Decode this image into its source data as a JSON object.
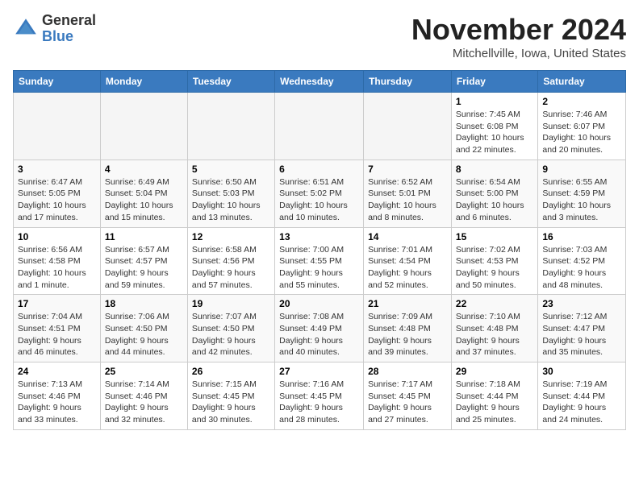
{
  "header": {
    "logo_line1": "General",
    "logo_line2": "Blue",
    "month": "November 2024",
    "location": "Mitchellville, Iowa, United States"
  },
  "weekdays": [
    "Sunday",
    "Monday",
    "Tuesday",
    "Wednesday",
    "Thursday",
    "Friday",
    "Saturday"
  ],
  "weeks": [
    [
      {
        "day": "",
        "info": ""
      },
      {
        "day": "",
        "info": ""
      },
      {
        "day": "",
        "info": ""
      },
      {
        "day": "",
        "info": ""
      },
      {
        "day": "",
        "info": ""
      },
      {
        "day": "1",
        "info": "Sunrise: 7:45 AM\nSunset: 6:08 PM\nDaylight: 10 hours and 22 minutes."
      },
      {
        "day": "2",
        "info": "Sunrise: 7:46 AM\nSunset: 6:07 PM\nDaylight: 10 hours and 20 minutes."
      }
    ],
    [
      {
        "day": "3",
        "info": "Sunrise: 6:47 AM\nSunset: 5:05 PM\nDaylight: 10 hours and 17 minutes."
      },
      {
        "day": "4",
        "info": "Sunrise: 6:49 AM\nSunset: 5:04 PM\nDaylight: 10 hours and 15 minutes."
      },
      {
        "day": "5",
        "info": "Sunrise: 6:50 AM\nSunset: 5:03 PM\nDaylight: 10 hours and 13 minutes."
      },
      {
        "day": "6",
        "info": "Sunrise: 6:51 AM\nSunset: 5:02 PM\nDaylight: 10 hours and 10 minutes."
      },
      {
        "day": "7",
        "info": "Sunrise: 6:52 AM\nSunset: 5:01 PM\nDaylight: 10 hours and 8 minutes."
      },
      {
        "day": "8",
        "info": "Sunrise: 6:54 AM\nSunset: 5:00 PM\nDaylight: 10 hours and 6 minutes."
      },
      {
        "day": "9",
        "info": "Sunrise: 6:55 AM\nSunset: 4:59 PM\nDaylight: 10 hours and 3 minutes."
      }
    ],
    [
      {
        "day": "10",
        "info": "Sunrise: 6:56 AM\nSunset: 4:58 PM\nDaylight: 10 hours and 1 minute."
      },
      {
        "day": "11",
        "info": "Sunrise: 6:57 AM\nSunset: 4:57 PM\nDaylight: 9 hours and 59 minutes."
      },
      {
        "day": "12",
        "info": "Sunrise: 6:58 AM\nSunset: 4:56 PM\nDaylight: 9 hours and 57 minutes."
      },
      {
        "day": "13",
        "info": "Sunrise: 7:00 AM\nSunset: 4:55 PM\nDaylight: 9 hours and 55 minutes."
      },
      {
        "day": "14",
        "info": "Sunrise: 7:01 AM\nSunset: 4:54 PM\nDaylight: 9 hours and 52 minutes."
      },
      {
        "day": "15",
        "info": "Sunrise: 7:02 AM\nSunset: 4:53 PM\nDaylight: 9 hours and 50 minutes."
      },
      {
        "day": "16",
        "info": "Sunrise: 7:03 AM\nSunset: 4:52 PM\nDaylight: 9 hours and 48 minutes."
      }
    ],
    [
      {
        "day": "17",
        "info": "Sunrise: 7:04 AM\nSunset: 4:51 PM\nDaylight: 9 hours and 46 minutes."
      },
      {
        "day": "18",
        "info": "Sunrise: 7:06 AM\nSunset: 4:50 PM\nDaylight: 9 hours and 44 minutes."
      },
      {
        "day": "19",
        "info": "Sunrise: 7:07 AM\nSunset: 4:50 PM\nDaylight: 9 hours and 42 minutes."
      },
      {
        "day": "20",
        "info": "Sunrise: 7:08 AM\nSunset: 4:49 PM\nDaylight: 9 hours and 40 minutes."
      },
      {
        "day": "21",
        "info": "Sunrise: 7:09 AM\nSunset: 4:48 PM\nDaylight: 9 hours and 39 minutes."
      },
      {
        "day": "22",
        "info": "Sunrise: 7:10 AM\nSunset: 4:48 PM\nDaylight: 9 hours and 37 minutes."
      },
      {
        "day": "23",
        "info": "Sunrise: 7:12 AM\nSunset: 4:47 PM\nDaylight: 9 hours and 35 minutes."
      }
    ],
    [
      {
        "day": "24",
        "info": "Sunrise: 7:13 AM\nSunset: 4:46 PM\nDaylight: 9 hours and 33 minutes."
      },
      {
        "day": "25",
        "info": "Sunrise: 7:14 AM\nSunset: 4:46 PM\nDaylight: 9 hours and 32 minutes."
      },
      {
        "day": "26",
        "info": "Sunrise: 7:15 AM\nSunset: 4:45 PM\nDaylight: 9 hours and 30 minutes."
      },
      {
        "day": "27",
        "info": "Sunrise: 7:16 AM\nSunset: 4:45 PM\nDaylight: 9 hours and 28 minutes."
      },
      {
        "day": "28",
        "info": "Sunrise: 7:17 AM\nSunset: 4:45 PM\nDaylight: 9 hours and 27 minutes."
      },
      {
        "day": "29",
        "info": "Sunrise: 7:18 AM\nSunset: 4:44 PM\nDaylight: 9 hours and 25 minutes."
      },
      {
        "day": "30",
        "info": "Sunrise: 7:19 AM\nSunset: 4:44 PM\nDaylight: 9 hours and 24 minutes."
      }
    ]
  ]
}
